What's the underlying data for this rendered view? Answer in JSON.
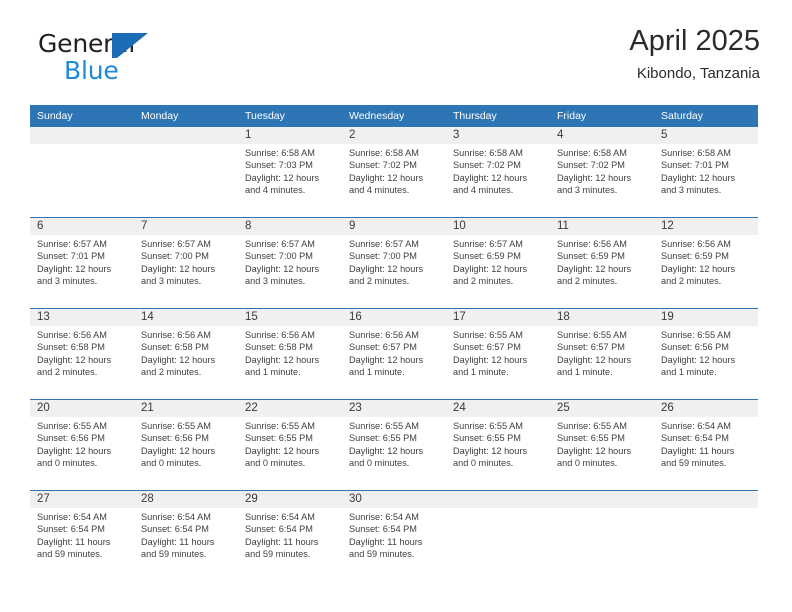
{
  "brand": {
    "line1": "General",
    "line2": "Blue",
    "logo_icon": "generalblue-triangle-logo",
    "colors": {
      "text_dark": "#231f20",
      "blue": "#1f8ad6",
      "mark": "#1b6cb5"
    }
  },
  "header": {
    "title": "April 2025",
    "subtitle": "Kibondo, Tanzania"
  },
  "theme": {
    "header_blue": "#2e75b6",
    "daynum_band": "#f0f0f0",
    "text": "#3f3f3f"
  },
  "calendar": {
    "weekday_headers": [
      "Sunday",
      "Monday",
      "Tuesday",
      "Wednesday",
      "Thursday",
      "Friday",
      "Saturday"
    ],
    "weeks": [
      [
        {
          "day": "",
          "sunrise": "",
          "sunset": "",
          "daylight": "",
          "empty": true
        },
        {
          "day": "",
          "sunrise": "",
          "sunset": "",
          "daylight": "",
          "empty": true
        },
        {
          "day": "1",
          "sunrise": "Sunrise: 6:58 AM",
          "sunset": "Sunset: 7:03 PM",
          "daylight": "Daylight: 12 hours and 4 minutes."
        },
        {
          "day": "2",
          "sunrise": "Sunrise: 6:58 AM",
          "sunset": "Sunset: 7:02 PM",
          "daylight": "Daylight: 12 hours and 4 minutes."
        },
        {
          "day": "3",
          "sunrise": "Sunrise: 6:58 AM",
          "sunset": "Sunset: 7:02 PM",
          "daylight": "Daylight: 12 hours and 4 minutes."
        },
        {
          "day": "4",
          "sunrise": "Sunrise: 6:58 AM",
          "sunset": "Sunset: 7:02 PM",
          "daylight": "Daylight: 12 hours and 3 minutes."
        },
        {
          "day": "5",
          "sunrise": "Sunrise: 6:58 AM",
          "sunset": "Sunset: 7:01 PM",
          "daylight": "Daylight: 12 hours and 3 minutes."
        }
      ],
      [
        {
          "day": "6",
          "sunrise": "Sunrise: 6:57 AM",
          "sunset": "Sunset: 7:01 PM",
          "daylight": "Daylight: 12 hours and 3 minutes."
        },
        {
          "day": "7",
          "sunrise": "Sunrise: 6:57 AM",
          "sunset": "Sunset: 7:00 PM",
          "daylight": "Daylight: 12 hours and 3 minutes."
        },
        {
          "day": "8",
          "sunrise": "Sunrise: 6:57 AM",
          "sunset": "Sunset: 7:00 PM",
          "daylight": "Daylight: 12 hours and 3 minutes."
        },
        {
          "day": "9",
          "sunrise": "Sunrise: 6:57 AM",
          "sunset": "Sunset: 7:00 PM",
          "daylight": "Daylight: 12 hours and 2 minutes."
        },
        {
          "day": "10",
          "sunrise": "Sunrise: 6:57 AM",
          "sunset": "Sunset: 6:59 PM",
          "daylight": "Daylight: 12 hours and 2 minutes."
        },
        {
          "day": "11",
          "sunrise": "Sunrise: 6:56 AM",
          "sunset": "Sunset: 6:59 PM",
          "daylight": "Daylight: 12 hours and 2 minutes."
        },
        {
          "day": "12",
          "sunrise": "Sunrise: 6:56 AM",
          "sunset": "Sunset: 6:59 PM",
          "daylight": "Daylight: 12 hours and 2 minutes."
        }
      ],
      [
        {
          "day": "13",
          "sunrise": "Sunrise: 6:56 AM",
          "sunset": "Sunset: 6:58 PM",
          "daylight": "Daylight: 12 hours and 2 minutes."
        },
        {
          "day": "14",
          "sunrise": "Sunrise: 6:56 AM",
          "sunset": "Sunset: 6:58 PM",
          "daylight": "Daylight: 12 hours and 2 minutes."
        },
        {
          "day": "15",
          "sunrise": "Sunrise: 6:56 AM",
          "sunset": "Sunset: 6:58 PM",
          "daylight": "Daylight: 12 hours and 1 minute."
        },
        {
          "day": "16",
          "sunrise": "Sunrise: 6:56 AM",
          "sunset": "Sunset: 6:57 PM",
          "daylight": "Daylight: 12 hours and 1 minute."
        },
        {
          "day": "17",
          "sunrise": "Sunrise: 6:55 AM",
          "sunset": "Sunset: 6:57 PM",
          "daylight": "Daylight: 12 hours and 1 minute."
        },
        {
          "day": "18",
          "sunrise": "Sunrise: 6:55 AM",
          "sunset": "Sunset: 6:57 PM",
          "daylight": "Daylight: 12 hours and 1 minute."
        },
        {
          "day": "19",
          "sunrise": "Sunrise: 6:55 AM",
          "sunset": "Sunset: 6:56 PM",
          "daylight": "Daylight: 12 hours and 1 minute."
        }
      ],
      [
        {
          "day": "20",
          "sunrise": "Sunrise: 6:55 AM",
          "sunset": "Sunset: 6:56 PM",
          "daylight": "Daylight: 12 hours and 0 minutes."
        },
        {
          "day": "21",
          "sunrise": "Sunrise: 6:55 AM",
          "sunset": "Sunset: 6:56 PM",
          "daylight": "Daylight: 12 hours and 0 minutes."
        },
        {
          "day": "22",
          "sunrise": "Sunrise: 6:55 AM",
          "sunset": "Sunset: 6:55 PM",
          "daylight": "Daylight: 12 hours and 0 minutes."
        },
        {
          "day": "23",
          "sunrise": "Sunrise: 6:55 AM",
          "sunset": "Sunset: 6:55 PM",
          "daylight": "Daylight: 12 hours and 0 minutes."
        },
        {
          "day": "24",
          "sunrise": "Sunrise: 6:55 AM",
          "sunset": "Sunset: 6:55 PM",
          "daylight": "Daylight: 12 hours and 0 minutes."
        },
        {
          "day": "25",
          "sunrise": "Sunrise: 6:55 AM",
          "sunset": "Sunset: 6:55 PM",
          "daylight": "Daylight: 12 hours and 0 minutes."
        },
        {
          "day": "26",
          "sunrise": "Sunrise: 6:54 AM",
          "sunset": "Sunset: 6:54 PM",
          "daylight": "Daylight: 11 hours and 59 minutes."
        }
      ],
      [
        {
          "day": "27",
          "sunrise": "Sunrise: 6:54 AM",
          "sunset": "Sunset: 6:54 PM",
          "daylight": "Daylight: 11 hours and 59 minutes."
        },
        {
          "day": "28",
          "sunrise": "Sunrise: 6:54 AM",
          "sunset": "Sunset: 6:54 PM",
          "daylight": "Daylight: 11 hours and 59 minutes."
        },
        {
          "day": "29",
          "sunrise": "Sunrise: 6:54 AM",
          "sunset": "Sunset: 6:54 PM",
          "daylight": "Daylight: 11 hours and 59 minutes."
        },
        {
          "day": "30",
          "sunrise": "Sunrise: 6:54 AM",
          "sunset": "Sunset: 6:54 PM",
          "daylight": "Daylight: 11 hours and 59 minutes."
        },
        {
          "day": "",
          "sunrise": "",
          "sunset": "",
          "daylight": "",
          "empty": true
        },
        {
          "day": "",
          "sunrise": "",
          "sunset": "",
          "daylight": "",
          "empty": true
        },
        {
          "day": "",
          "sunrise": "",
          "sunset": "",
          "daylight": "",
          "empty": true
        }
      ]
    ]
  }
}
